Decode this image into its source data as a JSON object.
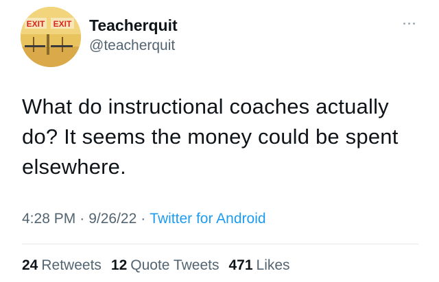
{
  "tweet": {
    "author": {
      "display_name": "Teacherquit",
      "handle": "@teacherquit",
      "avatar_sign_text_1": "EXIT",
      "avatar_sign_text_2": "EXIT"
    },
    "more_icon": "more-horizontal-icon",
    "text": "What do instructional coaches actually do? It seems the money could be spent elsewhere.",
    "time": "4:28 PM",
    "date": "9/26/22",
    "separator": "·",
    "source": "Twitter for Android",
    "stats": {
      "retweets": {
        "count": "24",
        "label": "Retweets"
      },
      "quote_tweets": {
        "count": "12",
        "label": "Quote Tweets"
      },
      "likes": {
        "count": "471",
        "label": "Likes"
      }
    }
  },
  "colors": {
    "text_primary": "#0f1419",
    "text_secondary": "#536471",
    "link": "#1d9bf0",
    "divider": "#e2e7eb"
  }
}
